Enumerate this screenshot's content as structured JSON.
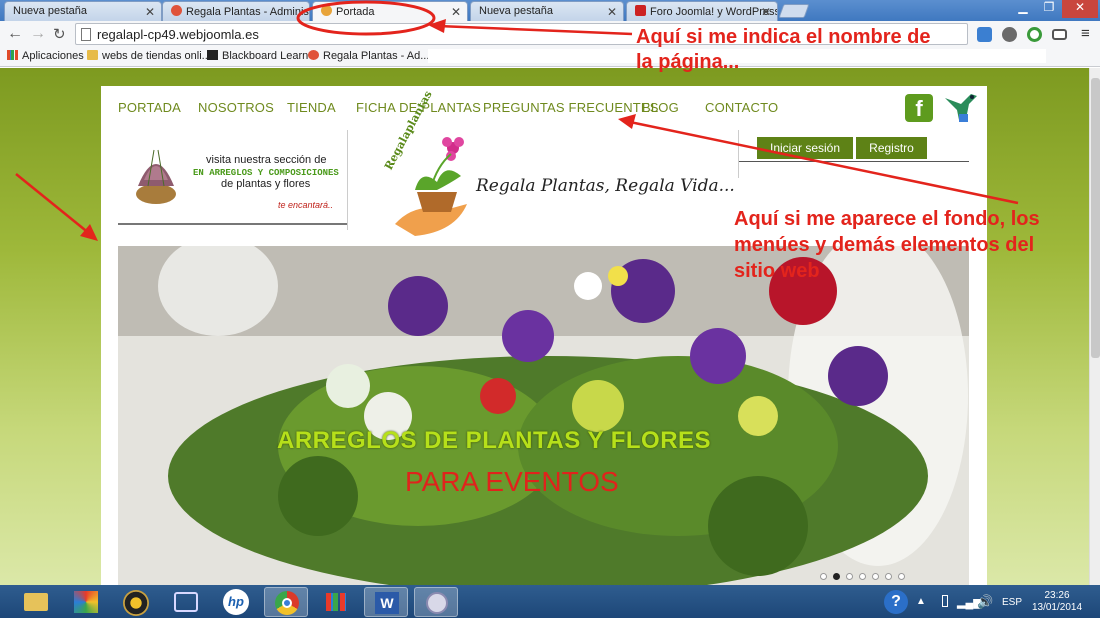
{
  "browser": {
    "tabs": [
      {
        "label": "Nueva pestaña",
        "active": false
      },
      {
        "label": "Regala Plantas - Administración",
        "active": false
      },
      {
        "label": "Portada",
        "active": true
      },
      {
        "label": "Nueva pestaña",
        "active": false
      },
      {
        "label": "Foro Joomla! y WordPress",
        "active": false
      }
    ],
    "address": "regalapl-cp49.webjoomla.es",
    "bookmarks": {
      "apps": "Aplicaciones",
      "items": [
        "webs de tiendas onli...",
        "Blackboard Learn",
        "Regala Plantas - Ad..."
      ]
    }
  },
  "site": {
    "menu": [
      "PORTADA",
      "NOSOTROS",
      "TIENDA",
      "FICHA DE PLANTAS",
      "PREGUNTAS FRECUENTES",
      "BLOG",
      "CONTACTO"
    ],
    "promo": {
      "line1": "visita nuestra sección de",
      "line2": "EN ARREGLOS Y COMPOSICIONES",
      "line3": "de plantas y flores",
      "line4": "te encantará.."
    },
    "logo": {
      "brand": "Regalaplantas",
      "tagline": "Regala Plantas, Regala Vida..."
    },
    "login_button": "Iniciar sesión",
    "register_button": "Registro",
    "slide": {
      "title": "ARREGLOS  DE PLANTAS Y FLORES",
      "subtitle": "PARA EVENTOS"
    }
  },
  "annotations": {
    "tab_note_l1": "Aquí si me indica el nombre de",
    "tab_note_l2": "la página...",
    "bg_note_l1": "Aquí si me aparece el fondo, los",
    "bg_note_l2": "menúes y demás elementos del",
    "bg_note_l3": "sitio web"
  },
  "taskbar": {
    "lang": "ESP",
    "time": "23:26",
    "date": "13/01/2014"
  },
  "colors": {
    "menu_text": "#6f8a1e",
    "menu_active_bg": "#f0f56a",
    "button_green": "#5e8216",
    "annotation_red": "#e3241c"
  }
}
